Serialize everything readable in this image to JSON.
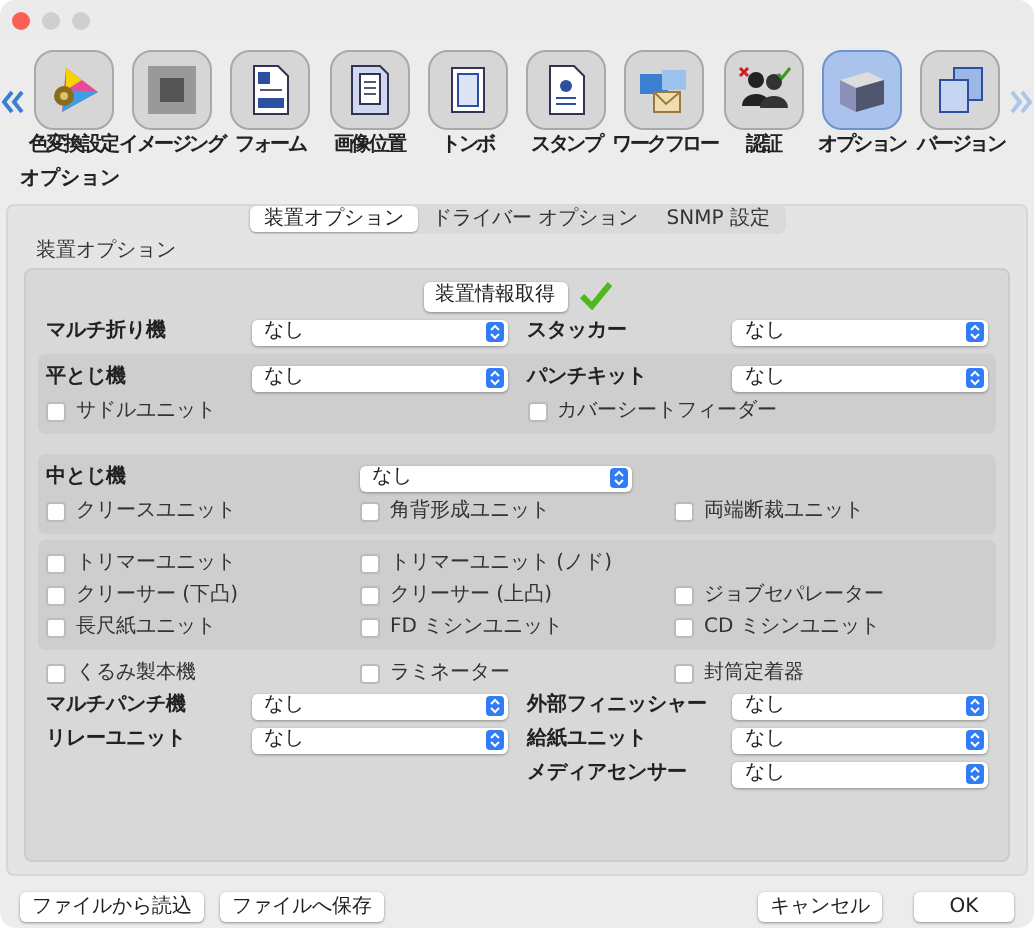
{
  "toolbar": {
    "items": [
      {
        "label": "色変換設定",
        "selected": false
      },
      {
        "label": "イメージング",
        "selected": false
      },
      {
        "label": "フォーム",
        "selected": false
      },
      {
        "label": "画像位置",
        "selected": false
      },
      {
        "label": "トンボ",
        "selected": false
      },
      {
        "label": "スタンプ",
        "selected": false
      },
      {
        "label": "ワークフロー",
        "selected": false
      },
      {
        "label": "認証",
        "selected": false
      },
      {
        "label": "オプション",
        "selected": true
      },
      {
        "label": "バージョン",
        "selected": false
      }
    ]
  },
  "section_title": "オプション",
  "tabs": [
    {
      "label": "装置オプション",
      "selected": true
    },
    {
      "label": "ドライバー オプション",
      "selected": false
    },
    {
      "label": "SNMP 設定",
      "selected": false
    }
  ],
  "group_title": "装置オプション",
  "fetch_button": "装置情報取得",
  "fetch_ok": true,
  "top_row": [
    {
      "label": "マルチ折り機",
      "value": "なし"
    },
    {
      "label": "スタッカー",
      "value": "なし"
    }
  ],
  "groups": [
    {
      "rows": [
        {
          "kind": "selects",
          "items": [
            {
              "label": "平とじ機",
              "value": "なし"
            },
            {
              "label": "パンチキット",
              "value": "なし"
            }
          ]
        },
        {
          "kind": "checks2",
          "items": [
            {
              "label": "サドルユニット",
              "checked": false
            },
            {
              "label": "カバーシートフィーダー",
              "checked": false
            }
          ]
        }
      ]
    },
    {
      "rows": [
        {
          "kind": "select3",
          "items": [
            {
              "label": "中とじ機",
              "value": "なし"
            }
          ]
        },
        {
          "kind": "checks",
          "items": [
            {
              "label": "クリースユニット",
              "checked": false
            },
            {
              "label": "角背形成ユニット",
              "checked": false
            },
            {
              "label": "両端断裁ユニット",
              "checked": false
            }
          ]
        }
      ]
    },
    {
      "rows": [
        {
          "kind": "checks",
          "items": [
            {
              "label": "トリマーユニット",
              "checked": false
            },
            {
              "label": "トリマーユニット (ノド)",
              "checked": false
            }
          ]
        },
        {
          "kind": "checks",
          "items": [
            {
              "label": "クリーサー (下凸)",
              "checked": false
            },
            {
              "label": "クリーサー (上凸)",
              "checked": false
            },
            {
              "label": "ジョブセパレーター",
              "checked": false
            }
          ]
        },
        {
          "kind": "checks",
          "items": [
            {
              "label": "長尺紙ユニット",
              "checked": false
            },
            {
              "label": "FD ミシンユニット",
              "checked": false
            },
            {
              "label": "CD ミシンユニット",
              "checked": false
            }
          ]
        }
      ]
    }
  ],
  "bottom_rows": [
    {
      "kind": "checks",
      "items": [
        {
          "label": "くるみ製本機",
          "checked": false
        },
        {
          "label": "ラミネーター",
          "checked": false
        },
        {
          "label": "封筒定着器",
          "checked": false
        }
      ]
    },
    {
      "kind": "selects",
      "items": [
        {
          "label": "マルチパンチ機",
          "value": "なし"
        },
        {
          "label": "外部フィニッシャー",
          "value": "なし"
        }
      ]
    },
    {
      "kind": "selects",
      "items": [
        {
          "label": "リレーユニット",
          "value": "なし"
        },
        {
          "label": "給紙ユニット",
          "value": "なし"
        }
      ]
    },
    {
      "kind": "selects",
      "right_only": true,
      "items": [
        {
          "label": "メディアセンサー",
          "value": "なし"
        }
      ]
    }
  ],
  "left_buttons": [
    "ファイルから読込",
    "ファイルへ保存"
  ],
  "right_buttons": [
    "キャンセル",
    "OK"
  ]
}
